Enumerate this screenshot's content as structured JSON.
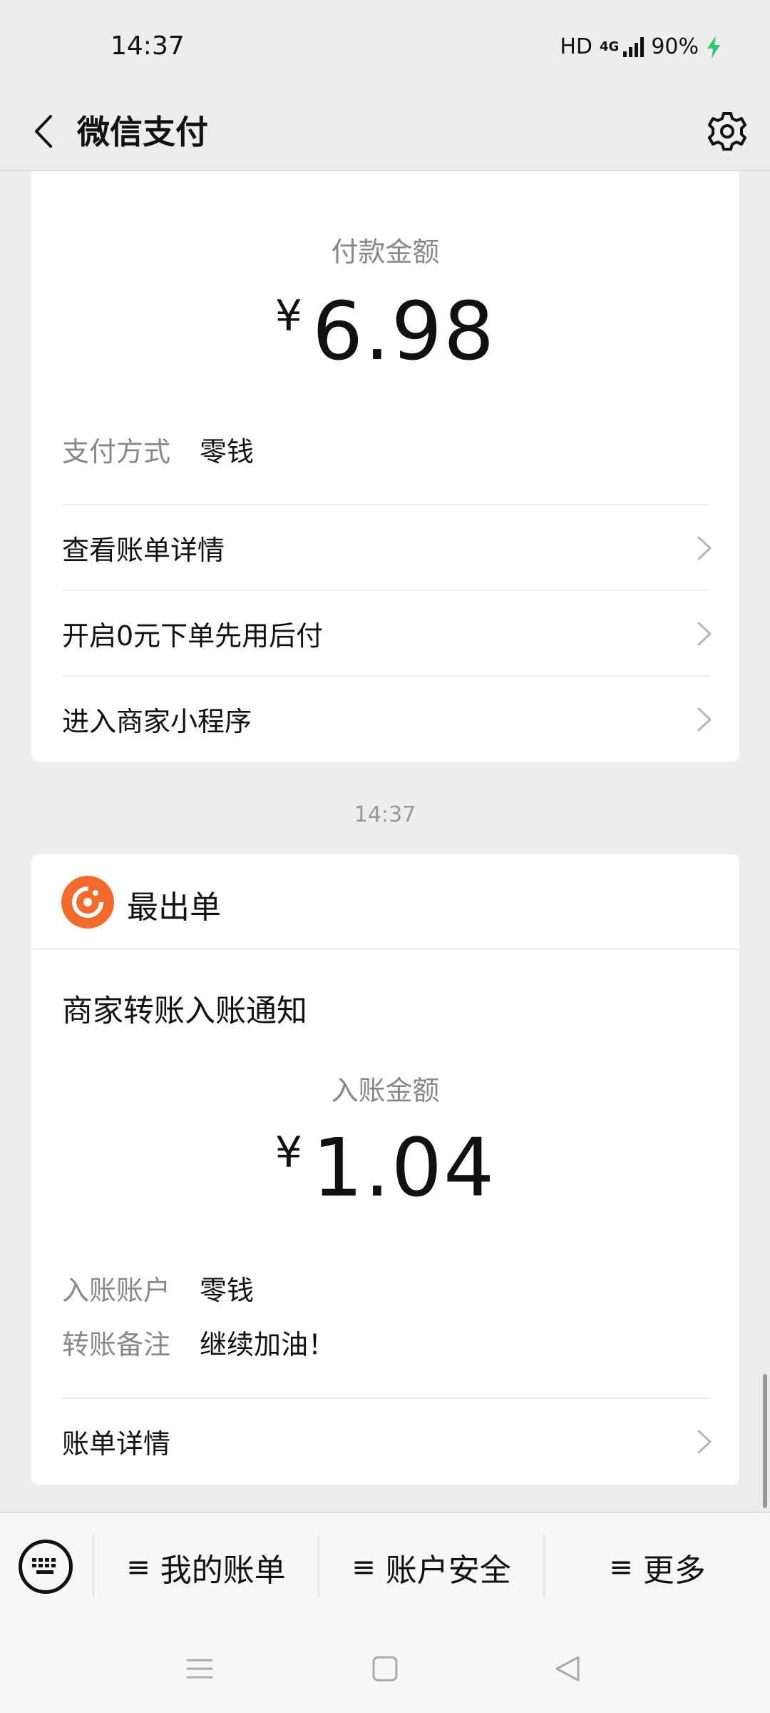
{
  "status_bar": {
    "time": "14:37",
    "hd": "HD",
    "network": "4G",
    "battery": "90%"
  },
  "nav": {
    "title": "微信支付"
  },
  "payment_card": {
    "amount_label": "付款金额",
    "currency": "¥",
    "amount": "6.98",
    "method_label": "支付方式",
    "method_value": "零钱",
    "rows": [
      {
        "label": "查看账单详情"
      },
      {
        "label": "开启0元下单先用后付"
      },
      {
        "label": "进入商家小程序"
      }
    ]
  },
  "timestamp": "14:37",
  "transfer_card": {
    "merchant_name": "最出单",
    "title": "商家转账入账通知",
    "amount_label": "入账金额",
    "currency": "¥",
    "amount": "1.04",
    "account_label": "入账账户",
    "account_value": "零钱",
    "remark_label": "转账备注",
    "remark_value": "继续加油！",
    "detail_label": "账单详情"
  },
  "bottom_menu": {
    "items": [
      {
        "label": "我的账单"
      },
      {
        "label": "账户安全"
      },
      {
        "label": "更多"
      }
    ]
  },
  "colors": {
    "background": "#ededed",
    "card": "#ffffff",
    "merchant_logo": "#f26a2c",
    "battery_bolt": "#2ecc71"
  }
}
